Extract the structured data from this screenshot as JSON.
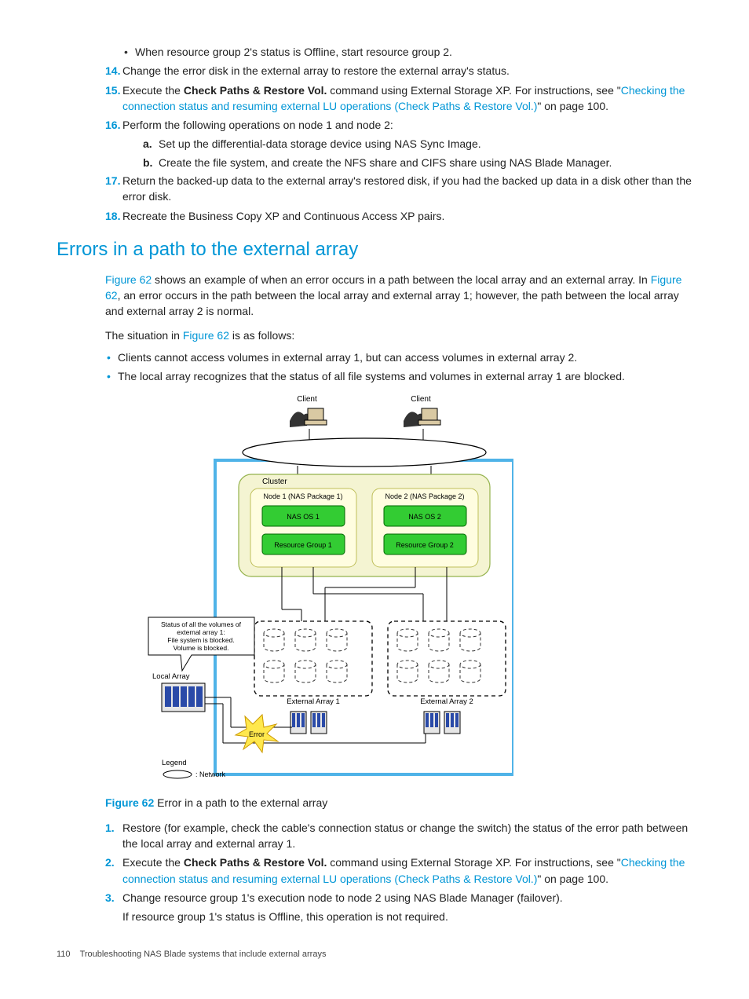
{
  "top_items": {
    "bullet13a": "When resource group 2's status is Offline, start resource group 2.",
    "n14": "14.",
    "t14": "Change the error disk in the external array to restore the external array's status.",
    "n15": "15.",
    "t15a": "Execute the ",
    "t15b": "Check Paths & Restore Vol.",
    "t15c": " command using External Storage XP. For instructions, see \"",
    "t15link": "Checking the connection status and resuming external LU operations (Check Paths & Restore Vol.)",
    "t15d": "\" on page 100.",
    "n16": "16.",
    "t16": "Perform the following operations on node 1 and node 2:",
    "a16a": "a.",
    "t16a": "Set up the differential-data storage device using NAS Sync Image.",
    "a16b": "b.",
    "t16b": "Create the file system, and create the NFS share and CIFS share using NAS Blade Manager.",
    "n17": "17.",
    "t17": "Return the backed-up data to the external array's restored disk, if you had the backed up data in a disk other than the error disk.",
    "n18": "18.",
    "t18": "Recreate the Business Copy XP and Continuous Access XP pairs."
  },
  "heading": "Errors in a path to the external array",
  "intro": {
    "p1a": "Figure 62",
    "p1b": " shows an example of when an error occurs in a path between the local array and an external array. In ",
    "p1c": "Figure 62",
    "p1d": ", an error occurs in the path between the local array and external array 1; however, the path between the local array and external array 2 is normal.",
    "p2a": "The situation in ",
    "p2b": "Figure 62",
    "p2c": " is as follows:",
    "b1": "Clients cannot access volumes in external array 1, but can access volumes in external array 2.",
    "b2": "The local array recognizes that the status of all file systems and volumes in external array 1 are blocked."
  },
  "diagram": {
    "client": "Client",
    "cluster": "Cluster",
    "node1": "Node 1 (NAS Package 1)",
    "node2": "Node 2 (NAS Package 2)",
    "nasos1": "NAS OS 1",
    "nasos2": "NAS OS 2",
    "rg1": "Resource Group 1",
    "rg2": "Resource Group 2",
    "status_l1": "Status of all the volumes of",
    "status_l2": "external array 1:",
    "status_l3": "File system is blocked.",
    "status_l4": "Volume is blocked.",
    "local_array": "Local Array",
    "ext1": "External Array 1",
    "ext2": "External Array 2",
    "error": "Error",
    "legend": "Legend",
    "legend_net": ": Network"
  },
  "figure": {
    "label": "Figure 62",
    "caption": "  Error in a path to the external array"
  },
  "steps": {
    "n1": "1.",
    "t1": "Restore (for example, check the cable's connection status or change the switch) the status of the error path between the local array and external array 1.",
    "n2": "2.",
    "t2a": "Execute the ",
    "t2b": "Check Paths & Restore Vol.",
    "t2c": " command using External Storage XP. For instructions, see \"",
    "t2link": "Checking the connection status and resuming external LU operations (Check Paths & Restore Vol.)",
    "t2d": "\" on page 100.",
    "n3": "3.",
    "t3": "Change resource group 1's execution node to node 2 using NAS Blade Manager (failover).",
    "t3b": "If resource group 1's status is Offline, this operation is not required."
  },
  "footer": {
    "page": "110",
    "title": "Troubleshooting NAS Blade systems that include external arrays"
  }
}
